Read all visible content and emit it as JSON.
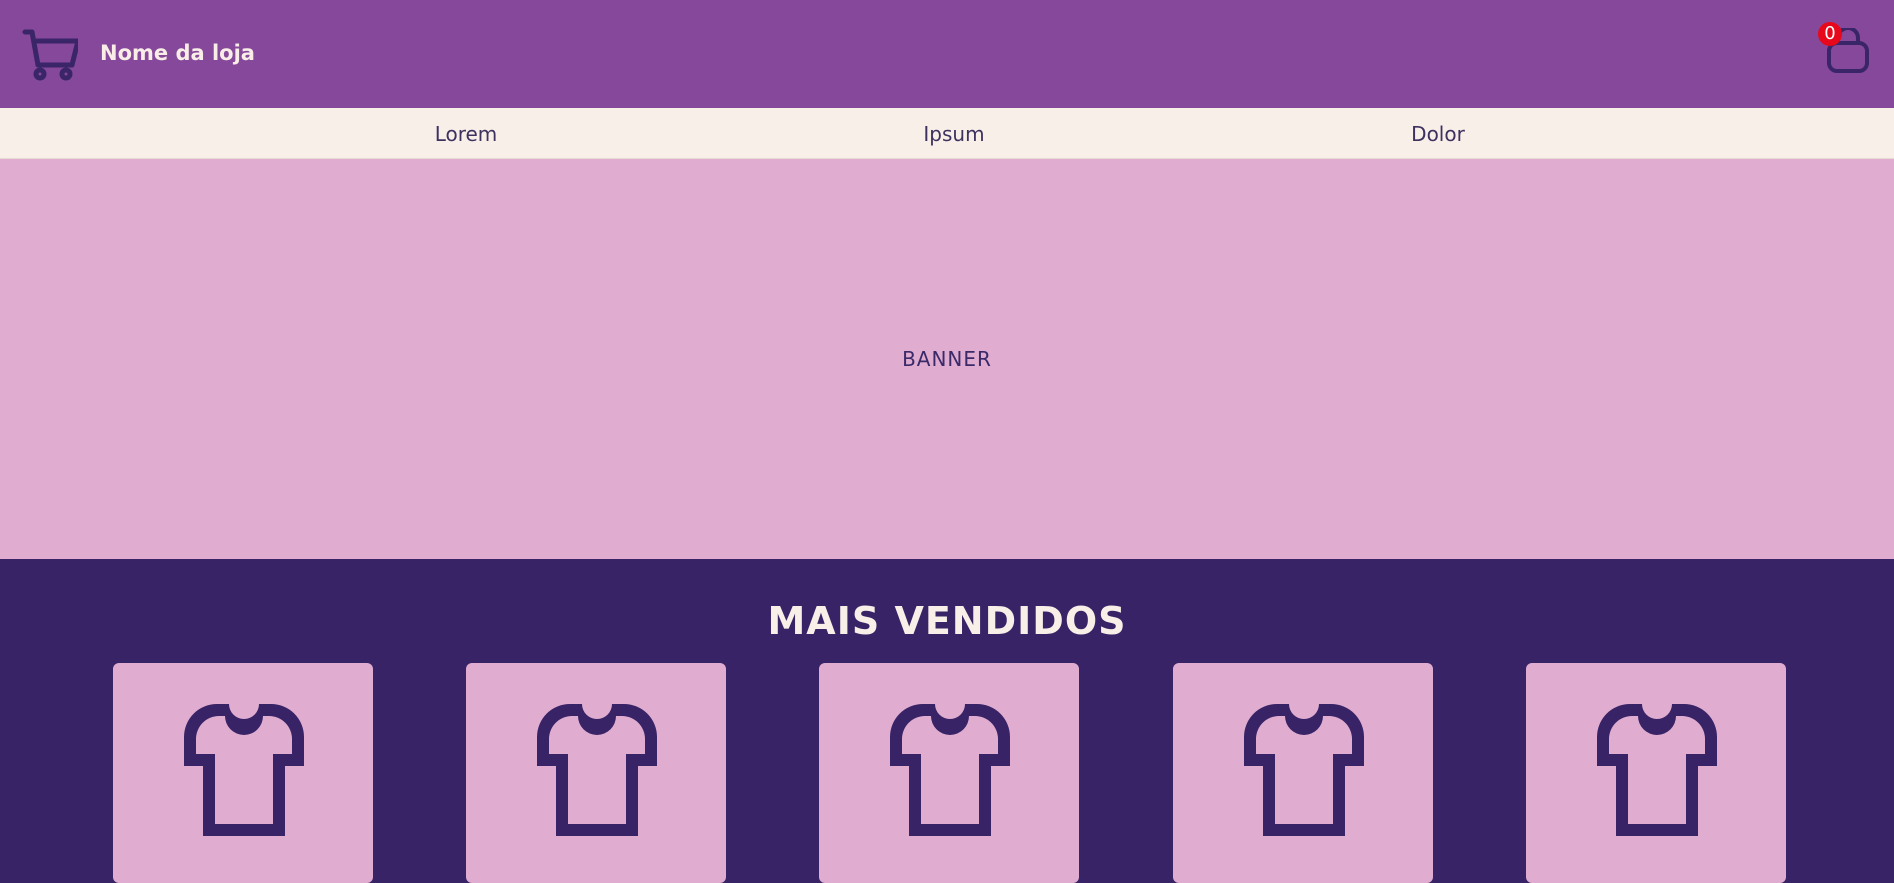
{
  "header": {
    "logo_icon": "shopping-cart-icon",
    "store_name": "Nome da loja",
    "cart_icon": "shopping-bag-icon",
    "cart_count": "0"
  },
  "nav": {
    "items": [
      {
        "label": "Lorem"
      },
      {
        "label": "Ipsum"
      },
      {
        "label": "Dolor"
      }
    ]
  },
  "banner": {
    "text": "BANNER"
  },
  "best_sellers": {
    "title": "MAIS VENDIDOS",
    "products": [
      {
        "icon": "t-shirt-icon"
      },
      {
        "icon": "t-shirt-icon"
      },
      {
        "icon": "t-shirt-icon"
      },
      {
        "icon": "t-shirt-icon"
      },
      {
        "icon": "t-shirt-icon"
      }
    ]
  },
  "colors": {
    "header_bg": "#86489a",
    "nav_bg": "#f8efe8",
    "banner_bg": "#e0add1",
    "section_bg": "#382366",
    "icon_color": "#3b2569",
    "badge": "#e8081b"
  }
}
